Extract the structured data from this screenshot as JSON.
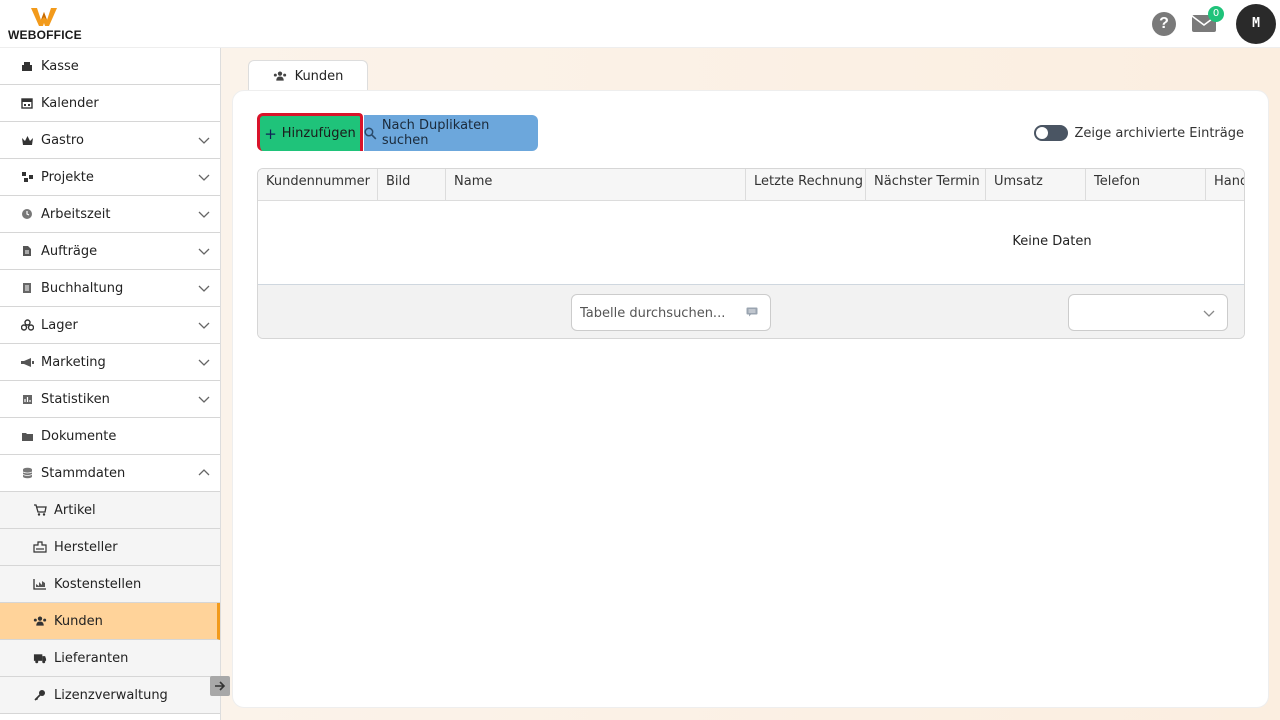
{
  "header": {
    "logo_text": "WEBOFFICE",
    "help_label": "?",
    "mail_count": "0",
    "avatar_initial": "M"
  },
  "sidebar": {
    "items": [
      {
        "label": "Kasse",
        "icon": "cash-register-icon",
        "expandable": false
      },
      {
        "label": "Kalender",
        "icon": "calendar-icon",
        "expandable": false
      },
      {
        "label": "Gastro",
        "icon": "crown-icon",
        "expandable": true
      },
      {
        "label": "Projekte",
        "icon": "project-nodes-icon",
        "expandable": true
      },
      {
        "label": "Arbeitszeit",
        "icon": "clock-icon",
        "expandable": true
      },
      {
        "label": "Aufträge",
        "icon": "document-icon",
        "expandable": true
      },
      {
        "label": "Buchhaltung",
        "icon": "ledger-icon",
        "expandable": true
      },
      {
        "label": "Lager",
        "icon": "boxes-icon",
        "expandable": true
      },
      {
        "label": "Marketing",
        "icon": "megaphone-icon",
        "expandable": true
      },
      {
        "label": "Statistiken",
        "icon": "bar-chart-icon",
        "expandable": true
      },
      {
        "label": "Dokumente",
        "icon": "folder-icon",
        "expandable": false
      },
      {
        "label": "Stammdaten",
        "icon": "database-icon",
        "expandable": true,
        "expanded": true
      }
    ],
    "sub_items": [
      {
        "label": "Artikel",
        "icon": "cart-icon"
      },
      {
        "label": "Hersteller",
        "icon": "factory-icon"
      },
      {
        "label": "Kostenstellen",
        "icon": "cost-chart-icon"
      },
      {
        "label": "Kunden",
        "icon": "users-icon",
        "active": true
      },
      {
        "label": "Lieferanten",
        "icon": "truck-icon"
      },
      {
        "label": "Lizenzverwaltung",
        "icon": "key-icon"
      }
    ]
  },
  "main": {
    "tab_label": "Kunden",
    "add_button": "Hinzufügen",
    "duplicates_button": "Nach Duplikaten suchen",
    "archive_toggle_label": "Zeige archivierte Einträge",
    "table": {
      "columns": [
        "Kundennummer",
        "Bild",
        "Name",
        "Letzte Rechnung",
        "Nächster Termin",
        "Umsatz",
        "Telefon",
        "Hand"
      ],
      "empty_message": "Keine Daten",
      "search_placeholder": "Tabelle durchsuchen...",
      "page_size_value": ""
    }
  },
  "colors": {
    "accent_orange": "#f29a1b",
    "add_green": "#1fc37a",
    "dup_blue": "#6ca7dc",
    "active_bg": "#ffd39a"
  }
}
